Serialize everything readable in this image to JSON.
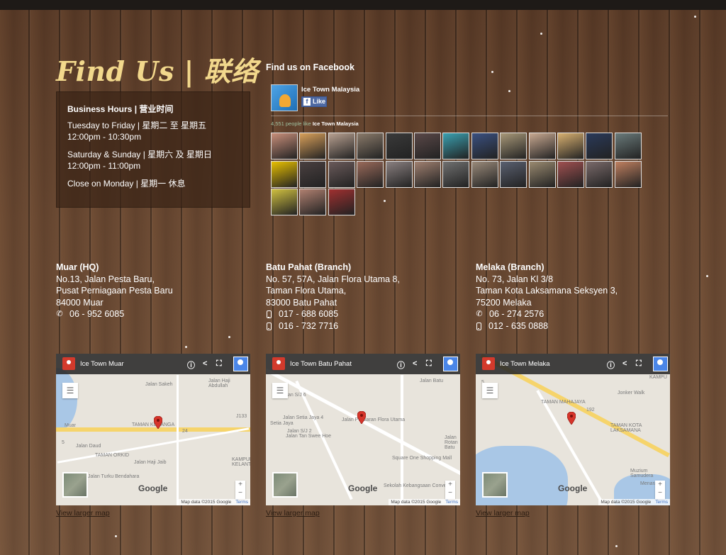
{
  "heading": "Find Us | 联络",
  "hours": {
    "title": "Business Hours | 营业时间",
    "weekday_days": "Tuesday to Friday | 星期二  至  星期五",
    "weekday_time": "12:00pm - 10:30pm",
    "weekend_days": "Saturday & Sunday | 星期六  及  星期日",
    "weekend_time": "12:00pm - 11:00pm",
    "closed": "Close on Monday | 星期一  休息"
  },
  "facebook": {
    "title": "Find us on Facebook",
    "page_name": "Ice Town Malaysia",
    "like_label": "Like",
    "like_icon": "facebook-f-icon",
    "likes_text": "4,551 people like",
    "likes_page": "Ice Town Malaysia",
    "fan_colors": [
      "#c98f7a",
      "#d9a05a",
      "#b8a090",
      "#8a7a6a",
      "#3a3a3a",
      "#5a4848",
      "#3aa0b0",
      "#3a5080",
      "#a89878",
      "#c8a890",
      "#d8b070",
      "#2a3a5a",
      "#6a7a7a",
      "#e8c000",
      "#4a4040",
      "#6a5a5a",
      "#9a6a5a",
      "#8a8080",
      "#a08070",
      "#707070",
      "#9a8a7a",
      "#5a6070",
      "#9a8a70",
      "#a05050",
      "#7a6a6a",
      "#c08060",
      "#d0c040",
      "#b08070",
      "#a03030"
    ]
  },
  "branches": [
    {
      "name": "Muar (HQ)",
      "lines": [
        "No.13, Jalan Pesta Baru,",
        "Pusat Perniagaan Pesta Baru",
        "84000 Muar"
      ],
      "phones": [
        {
          "icon": "phone-icon",
          "number": "06 - 952 6085"
        }
      ]
    },
    {
      "name": "Batu Pahat (Branch)",
      "lines": [
        "No. 57, 57A, Jalan Flora Utama 8,",
        "Taman Flora Utama,",
        "83000 Batu Pahat"
      ],
      "phones": [
        {
          "icon": "mobile-icon",
          "number": "017 - 688 6085"
        },
        {
          "icon": "mobile-icon",
          "number": "016 - 732 7716"
        }
      ]
    },
    {
      "name": "Melaka (Branch)",
      "lines": [
        "No. 73, Jalan Kl 3/8",
        "Taman Kota Laksamana Seksyen 3,",
        "75200 Melaka"
      ],
      "phones": [
        {
          "icon": "phone-icon",
          "number": "06 - 274 2576"
        },
        {
          "icon": "mobile-icon",
          "number": "012 - 635 0888"
        }
      ]
    }
  ],
  "maps": [
    {
      "title": "Ice Town Muar",
      "labels": [
        "Muar",
        "TAMAN KENANGA",
        "TAMAN ORKID",
        "Jalan Haji Jaib",
        "Jalan Daud",
        "Jalan Sakeh",
        "KAMPUNG KELANTAN",
        "Jalan Turku Bendahara",
        "Jalan Haji Abdullah",
        "24",
        "J133",
        "5"
      ]
    },
    {
      "title": "Ice Town Batu Pahat",
      "labels": [
        "Jalan Tan Swee Hoe",
        "Jalan Setia Jaya 4",
        "Setia Jaya",
        "Jalan S/J 2",
        "Jalan S/J 6",
        "Square One Shopping Mall",
        "Sekolah Kebangsaan Convent",
        "Jalan Persiaran Flora Utama",
        "Jalan Rotan Batu",
        "Jalan Batu"
      ]
    },
    {
      "title": "Ice Town Melaka",
      "labels": [
        "Jonker Walk",
        "TAMAN MAHAJAYA",
        "TAMAN KOTA LAKSAMANA",
        "Muzium Samudera",
        "Menara",
        "KAMPU",
        "192",
        "5"
      ]
    }
  ],
  "map_common": {
    "google": "Google",
    "attribution": "Map data ©2015 Google",
    "terms": "Terms",
    "view_larger": "View larger map",
    "zoom_in": "+",
    "zoom_out": "−"
  }
}
